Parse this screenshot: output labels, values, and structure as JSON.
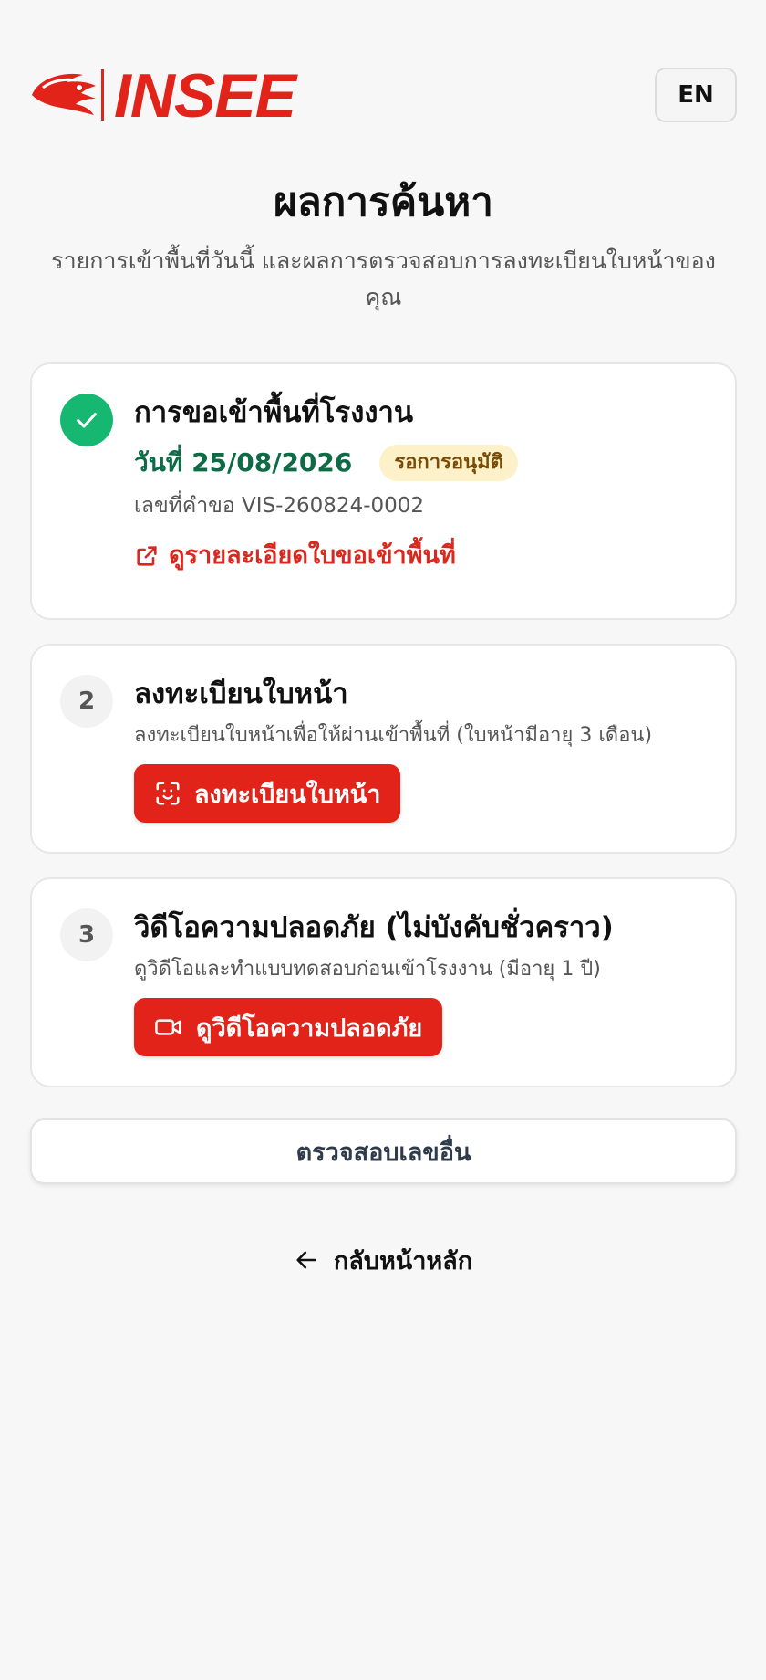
{
  "header": {
    "logo_text": "INSEE",
    "lang_button": "EN"
  },
  "page": {
    "title": "ผลการค้นหา",
    "subtitle": "รายการเข้าพื้นที่วันนี้ และผลการตรวจสอบการลงทะเบียนใบหน้าของคุณ"
  },
  "steps": [
    {
      "icon": "check-icon",
      "title": "การขอเข้าพื้นที่โรงงาน",
      "date": "วันที่ 25/08/2026",
      "status": "รอการอนุมัติ",
      "request_no": "เลขที่คำขอ VIS-260824-0002",
      "link_label": "ดูรายละเอียดใบขอเข้าพื้นที่"
    },
    {
      "number": "2",
      "title": "ลงทะเบียนใบหน้า",
      "description": "ลงทะเบียนใบหน้าเพื่อให้ผ่านเข้าพื้นที่ (ใบหน้ามีอายุ 3 เดือน)",
      "button_label": "ลงทะเบียนใบหน้า",
      "button_icon": "face-scan-icon"
    },
    {
      "number": "3",
      "title": "วิดีโอความปลอดภัย (ไม่บังคับชั่วคราว)",
      "description": "ดูวิดีโอและทำแบบทดสอบก่อนเข้าโรงงาน (มีอายุ 1 ปี)",
      "button_label": "ดูวิดีโอความปลอดภัย",
      "button_icon": "video-camera-icon"
    }
  ],
  "actions": {
    "check_other": "ตรวจสอบเลขอื่น",
    "back_home": "กลับหน้าหลัก"
  },
  "colors": {
    "brand_red": "#e2231a",
    "success_green": "#16b871",
    "date_green": "#0d6b46",
    "pending_bg": "#fdf1c9"
  }
}
